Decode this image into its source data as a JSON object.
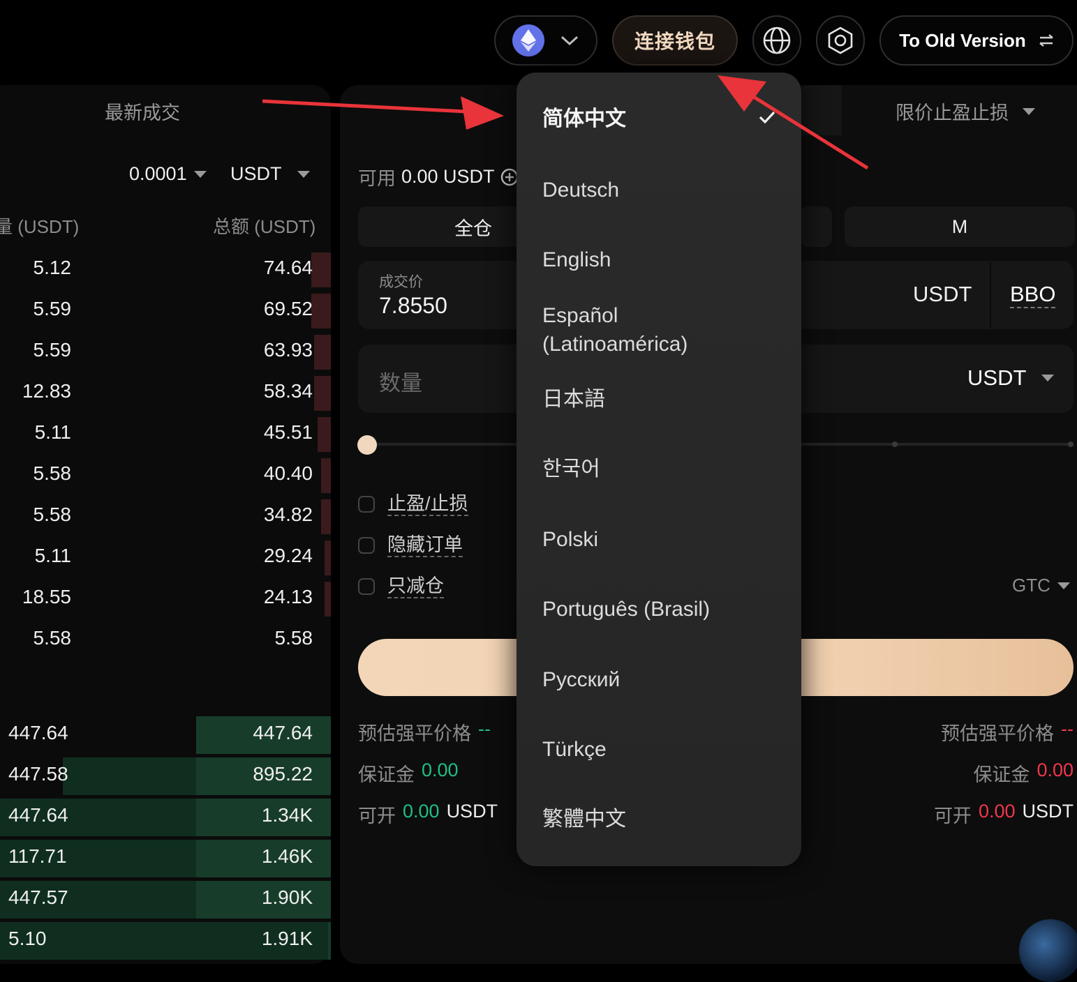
{
  "topbar": {
    "chain_icon": "ethereum-icon",
    "connect_wallet": "连接钱包",
    "old_version": "To Old Version"
  },
  "orderbook": {
    "tab_label": "最新成交",
    "precision": "0.0001",
    "unit": "USDT",
    "col_amount": "量 (USDT)",
    "col_total": "总额 (USDT)",
    "asks": [
      {
        "amount": "5.12",
        "total": "74.64",
        "depth": 0.06
      },
      {
        "amount": "5.59",
        "total": "69.52",
        "depth": 0.06
      },
      {
        "amount": "5.59",
        "total": "63.93",
        "depth": 0.05
      },
      {
        "amount": "12.83",
        "total": "58.34",
        "depth": 0.05
      },
      {
        "amount": "5.11",
        "total": "45.51",
        "depth": 0.04
      },
      {
        "amount": "5.58",
        "total": "40.40",
        "depth": 0.03
      },
      {
        "amount": "5.58",
        "total": "34.82",
        "depth": 0.03
      },
      {
        "amount": "5.11",
        "total": "29.24",
        "depth": 0.02
      },
      {
        "amount": "18.55",
        "total": "24.13",
        "depth": 0.02
      },
      {
        "amount": "5.58",
        "total": "5.58",
        "depth": 0.0
      }
    ],
    "bids": [
      {
        "amount": "447.64",
        "total": "447.64"
      },
      {
        "amount": "447.58",
        "total": "895.22"
      },
      {
        "amount": "447.64",
        "total": "1.34K"
      },
      {
        "amount": "117.71",
        "total": "1.46K"
      },
      {
        "amount": "447.57",
        "total": "1.90K"
      },
      {
        "amount": "5.10",
        "total": "1.91K"
      }
    ]
  },
  "order_form": {
    "order_type": "限价止盈止损",
    "available_label": "可用",
    "available_value": "0.00 USDT",
    "margin_mode": "全仓",
    "leverage": "M",
    "price_label": "成交价",
    "price_value": "7.8550",
    "price_unit": "USDT",
    "bbo": "BBO",
    "qty_placeholder": "数量",
    "qty_unit": "USDT",
    "slider_percent": 0,
    "options": [
      "止盈/止损",
      "隐藏订单",
      "只减仓"
    ],
    "tif": "GTC",
    "long": {
      "liq_label": "预估强平价格",
      "liq_value": "--",
      "margin_label": "保证金",
      "margin_value": "0.00",
      "open_label": "可开",
      "open_value": "0.00",
      "open_unit": "USDT"
    },
    "short": {
      "liq_label": "预估强平价格",
      "liq_value": "--",
      "margin_label": "保证金",
      "margin_value": "0.00",
      "open_label": "可开",
      "open_value": "0.00",
      "open_unit": "USDT"
    }
  },
  "language_menu": {
    "selected": "简体中文",
    "items": [
      "简体中文",
      "Deutsch",
      "English",
      "Español (Latinoamérica)",
      "日本語",
      "한국어",
      "Polski",
      "Português (Brasil)",
      "Русский",
      "Türkçe",
      "繁體中文"
    ]
  },
  "colors": {
    "accent": "#f0d7bd",
    "buy": "#1fbf84",
    "sell": "#f0374b",
    "annotation_arrow": "#e8343a"
  }
}
